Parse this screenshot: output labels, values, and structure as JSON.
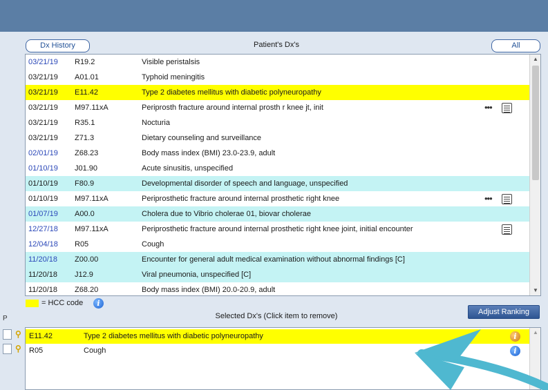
{
  "header": {
    "dx_history_label": "Dx History",
    "patients_dx_title": "Patient's Dx's",
    "all_label": "All"
  },
  "dx_rows": [
    {
      "date": "03/21/19",
      "code": "R19.2",
      "desc": "Visible peristalsis",
      "date_color": "blue",
      "highlight": "none",
      "more": false,
      "note": false
    },
    {
      "date": "03/21/19",
      "code": "A01.01",
      "desc": "Typhoid meningitis",
      "date_color": "black",
      "highlight": "none",
      "more": false,
      "note": false
    },
    {
      "date": "03/21/19",
      "code": "E11.42",
      "desc": "Type 2 diabetes mellitus with diabetic polyneuropathy",
      "date_color": "black",
      "highlight": "yellow",
      "more": false,
      "note": false
    },
    {
      "date": "03/21/19",
      "code": "M97.11xA",
      "desc": "Periprosth fracture around internal prosth r knee jt, init",
      "date_color": "black",
      "highlight": "none",
      "more": true,
      "note": true
    },
    {
      "date": "03/21/19",
      "code": "R35.1",
      "desc": "Nocturia",
      "date_color": "black",
      "highlight": "none",
      "more": false,
      "note": false
    },
    {
      "date": "03/21/19",
      "code": "Z71.3",
      "desc": "Dietary counseling and surveillance",
      "date_color": "black",
      "highlight": "none",
      "more": false,
      "note": false
    },
    {
      "date": "02/01/19",
      "code": "Z68.23",
      "desc": "Body mass index (BMI) 23.0-23.9, adult",
      "date_color": "blue",
      "highlight": "none",
      "more": false,
      "note": false
    },
    {
      "date": "01/10/19",
      "code": "J01.90",
      "desc": "Acute sinusitis, unspecified",
      "date_color": "blue",
      "highlight": "none",
      "more": false,
      "note": false
    },
    {
      "date": "01/10/19",
      "code": "F80.9",
      "desc": "Developmental disorder of speech and language, unspecified",
      "date_color": "black",
      "highlight": "cyan",
      "more": false,
      "note": false
    },
    {
      "date": "01/10/19",
      "code": "M97.11xA",
      "desc": "Periprosthetic fracture around internal prosthetic right knee",
      "date_color": "black",
      "highlight": "none",
      "more": true,
      "note": true
    },
    {
      "date": "01/07/19",
      "code": "A00.0",
      "desc": "Cholera due to Vibrio cholerae 01, biovar cholerae",
      "date_color": "blue",
      "highlight": "cyan",
      "more": false,
      "note": false
    },
    {
      "date": "12/27/18",
      "code": "M97.11xA",
      "desc": "Periprosthetic fracture around internal prosthetic right knee joint, initial encounter",
      "date_color": "blue",
      "highlight": "none",
      "more": false,
      "note": true
    },
    {
      "date": "12/04/18",
      "code": "R05",
      "desc": "Cough",
      "date_color": "blue",
      "highlight": "none",
      "more": false,
      "note": false
    },
    {
      "date": "11/20/18",
      "code": "Z00.00",
      "desc": "Encounter for general adult medical examination without abnormal findings [C]",
      "date_color": "blue",
      "highlight": "cyan",
      "more": false,
      "note": false
    },
    {
      "date": "11/20/18",
      "code": "J12.9",
      "desc": "Viral pneumonia, unspecified [C]",
      "date_color": "black",
      "highlight": "cyan",
      "more": false,
      "note": false
    },
    {
      "date": "11/20/18",
      "code": "Z68.20",
      "desc": "Body mass index (BMI) 20.0-20.9, adult",
      "date_color": "black",
      "highlight": "none",
      "more": false,
      "note": false
    }
  ],
  "legend": {
    "hcc_label": "= HCC code",
    "swatch_color": "#ffff00"
  },
  "selected": {
    "p_label": "P",
    "title": "Selected Dx's (Click item to remove)",
    "adjust_ranking_label": "Adjust Ranking",
    "rows": [
      {
        "code": "E11.42",
        "desc": "Type 2 diabetes mellitus with diabetic polyneuropathy",
        "highlight": "yellow",
        "info_icon": "info-orange-icon"
      },
      {
        "code": "R05",
        "desc": "Cough",
        "highlight": "none",
        "info_icon": "info-blue-icon"
      }
    ]
  },
  "colors": {
    "title_bar": "#5b7ea5",
    "panel_bg": "#dfe7f1",
    "hcc_yellow": "#ffff00",
    "cyan_highlight": "#c4f3f4",
    "blue_date": "#2a47b8",
    "annotation_arrow": "#4fb8d0"
  }
}
